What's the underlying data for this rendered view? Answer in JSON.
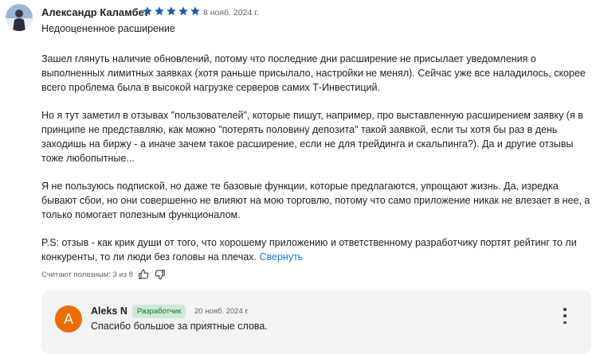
{
  "review": {
    "author": "Александр Каламбет",
    "rating": 5,
    "date": "8 нояб. 2024 г.",
    "title": "Недооцененное расширение",
    "paragraphs": [
      "Зашел глянуть наличие обновлений, потому что последние дни расширение не присылает уведомления о выполненных лимитных заявках (хотя раньше присылало, настройки не менял). Сейчас уже все наладилось, скорее всего проблема была в высокой нагрузке серверов самих Т-Инвестиций.",
      "Но я тут заметил в отзывах \"пользователей\", которые пишут, например, про выставленную расширением заявку (я в принципе не представляю, как можно \"потерять половину депозита\" такой заявкой, если ты хотя бы раз в день заходишь на биржу - а иначе зачем такое расширение, если не для трейдинга и скальпинга?). Да и другие отзывы тоже любопытные...",
      "Я не пользуюсь подпиской, но даже те базовые функции, которые предлагаются, упрощают жизнь. Да, изредка бывают сбои, но они совершенно не влияют на мою торговлю, потому что само приложение никак не влезает в нее, а только помогает полезным функционалом.",
      "P.S: отзыв - как крик души от того, что хорошему приложению и ответственному разработчику портят рейтинг то ли конкуренты, то ли люди без головы на плечах."
    ],
    "collapse_label": "Свернуть",
    "helpful_text": "Считают полезным: 3 из 8"
  },
  "reply": {
    "avatar_letter": "A",
    "name": "Aleks N",
    "badge": "Разработчик",
    "date": "20 нояб. 2024 г.",
    "text": "Спасибо большое за приятные слова."
  },
  "colors": {
    "star": "#1e5db5",
    "link": "#1a73e8",
    "reply_avatar": "#ef6c00",
    "badge_bg": "#ceead6",
    "badge_text": "#137333"
  },
  "icons": [
    "user-avatar-photo",
    "star-icon",
    "thumbs-up-icon",
    "thumbs-down-icon",
    "more-vert-icon"
  ]
}
